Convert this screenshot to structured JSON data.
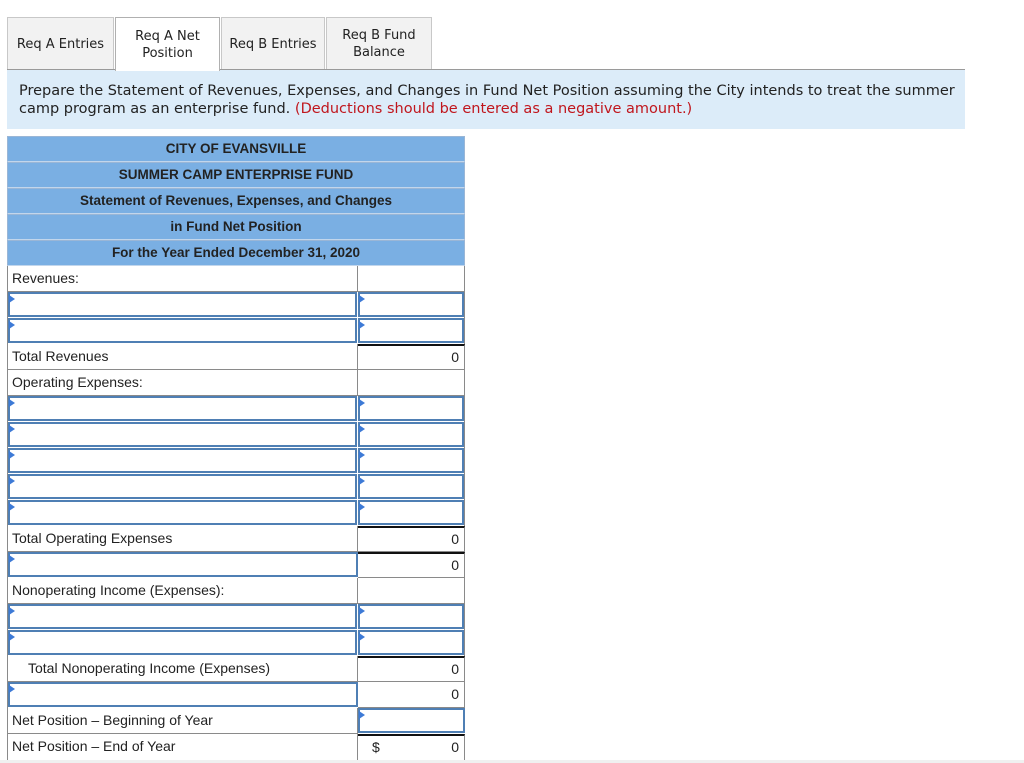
{
  "tabs": [
    {
      "label": "Req A Entries",
      "active": false
    },
    {
      "label": "Req A Net\nPosition",
      "active": true
    },
    {
      "label": "Req B Entries",
      "active": false
    },
    {
      "label": "Req B Fund\nBalance",
      "active": false
    }
  ],
  "instruction": {
    "text": "Prepare the Statement of Revenues, Expenses, and Changes in Fund Net Position assuming the City intends to treat the summer camp program as an enterprise fund.",
    "note": "(Deductions should be entered as a negative amount.)"
  },
  "statement": {
    "header": [
      "CITY OF EVANSVILLE",
      "SUMMER CAMP ENTERPRISE FUND",
      "Statement of Revenues, Expenses, and Changes",
      "in Fund Net Position",
      "For the Year Ended December 31, 2020"
    ],
    "revenues_label": "Revenues:",
    "total_revenues_label": "Total Revenues",
    "total_revenues_value": "0",
    "operating_expenses_label": "Operating Expenses:",
    "total_operating_expenses_label": "Total Operating Expenses",
    "total_operating_expenses_value": "0",
    "operating_income_value": "0",
    "nonoperating_label": "Nonoperating Income (Expenses):",
    "total_nonoperating_label": "Total Nonoperating Income (Expenses)",
    "total_nonoperating_value": "0",
    "change_value": "0",
    "net_position_begin_label": "Net Position – Beginning of Year",
    "net_position_end_label": "Net Position – End of Year",
    "currency_symbol": "$",
    "net_position_end_value": "0",
    "inputs": {
      "label_value": "",
      "amount_value": ""
    }
  }
}
